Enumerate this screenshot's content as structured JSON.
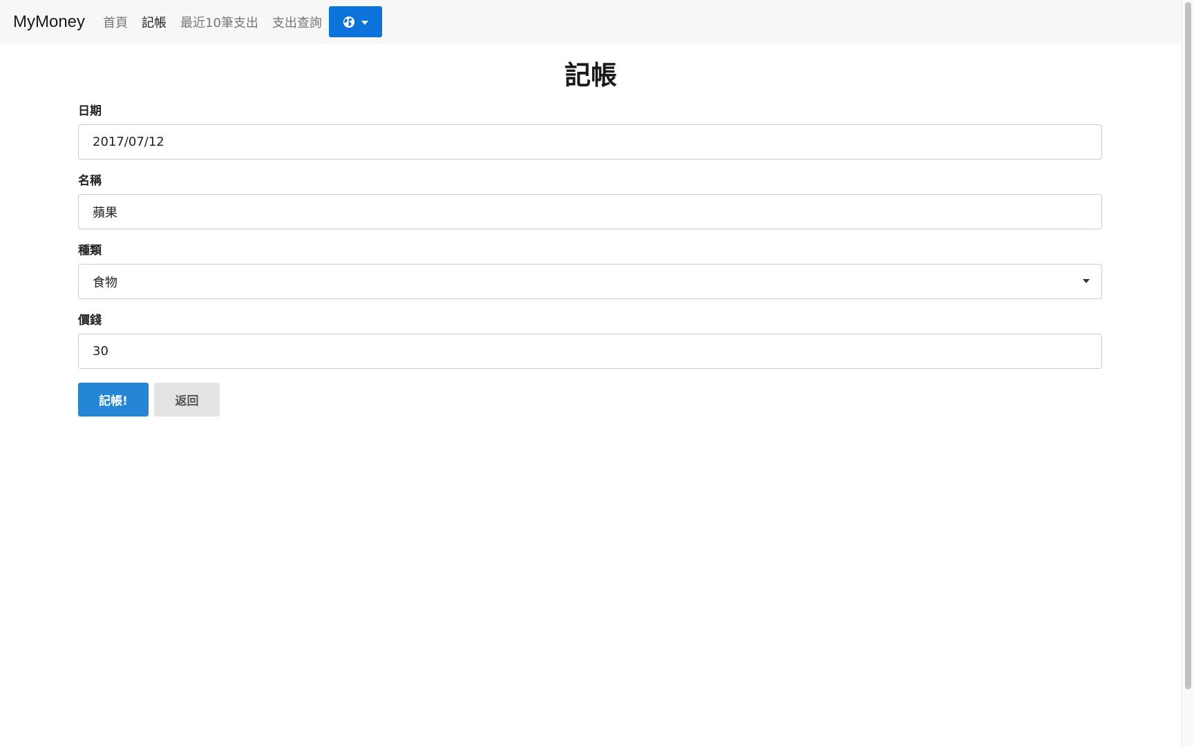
{
  "navbar": {
    "brand": "MyMoney",
    "links": [
      {
        "label": "首頁",
        "active": false
      },
      {
        "label": "記帳",
        "active": true
      },
      {
        "label": "最近10筆支出",
        "active": false
      },
      {
        "label": "支出查詢",
        "active": false
      }
    ],
    "language_button": {
      "icon": "globe-icon",
      "color": "#0b73d9"
    }
  },
  "page": {
    "title": "記帳"
  },
  "form": {
    "date": {
      "label": "日期",
      "value": "2017/07/12"
    },
    "name": {
      "label": "名稱",
      "value": "蘋果"
    },
    "category": {
      "label": "種類",
      "selected": "食物"
    },
    "price": {
      "label": "價錢",
      "value": "30"
    },
    "submit_label": "記帳!",
    "back_label": "返回"
  },
  "colors": {
    "primary": "#2585d7",
    "secondary": "#e4e4e4",
    "navbar_bg": "#f7f7f7"
  }
}
